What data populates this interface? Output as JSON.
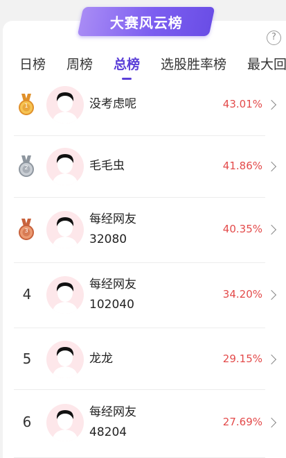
{
  "header": {
    "banner_title": "大赛风云榜",
    "help_symbol": "?"
  },
  "tabs": [
    {
      "label": "日榜",
      "active": false
    },
    {
      "label": "周榜",
      "active": false
    },
    {
      "label": "总榜",
      "active": true
    },
    {
      "label": "选股胜率榜",
      "active": false
    },
    {
      "label": "最大回",
      "active": false
    }
  ],
  "rows": [
    {
      "rank": "1",
      "medal": "gold-medal-icon",
      "name": "没考虑呢",
      "name2": "",
      "percent": "43.01%"
    },
    {
      "rank": "2",
      "medal": "silver-medal-icon",
      "name": "毛毛虫",
      "name2": "",
      "percent": "41.86%"
    },
    {
      "rank": "3",
      "medal": "bronze-medal-icon",
      "name": "每经网友",
      "name2": "32080",
      "percent": "40.35%"
    },
    {
      "rank": "4",
      "medal": "",
      "name": "每经网友",
      "name2": "102040",
      "percent": "34.20%"
    },
    {
      "rank": "5",
      "medal": "",
      "name": "龙龙",
      "name2": "",
      "percent": "29.15%"
    },
    {
      "rank": "6",
      "medal": "",
      "name": "每经网友",
      "name2": "48204",
      "percent": "27.69%"
    }
  ],
  "colors": {
    "accent": "#5b3fd8",
    "percent": "#e34a4a",
    "gold": "#f0a93a",
    "silver": "#9aa3ad",
    "bronze": "#d4754a"
  }
}
